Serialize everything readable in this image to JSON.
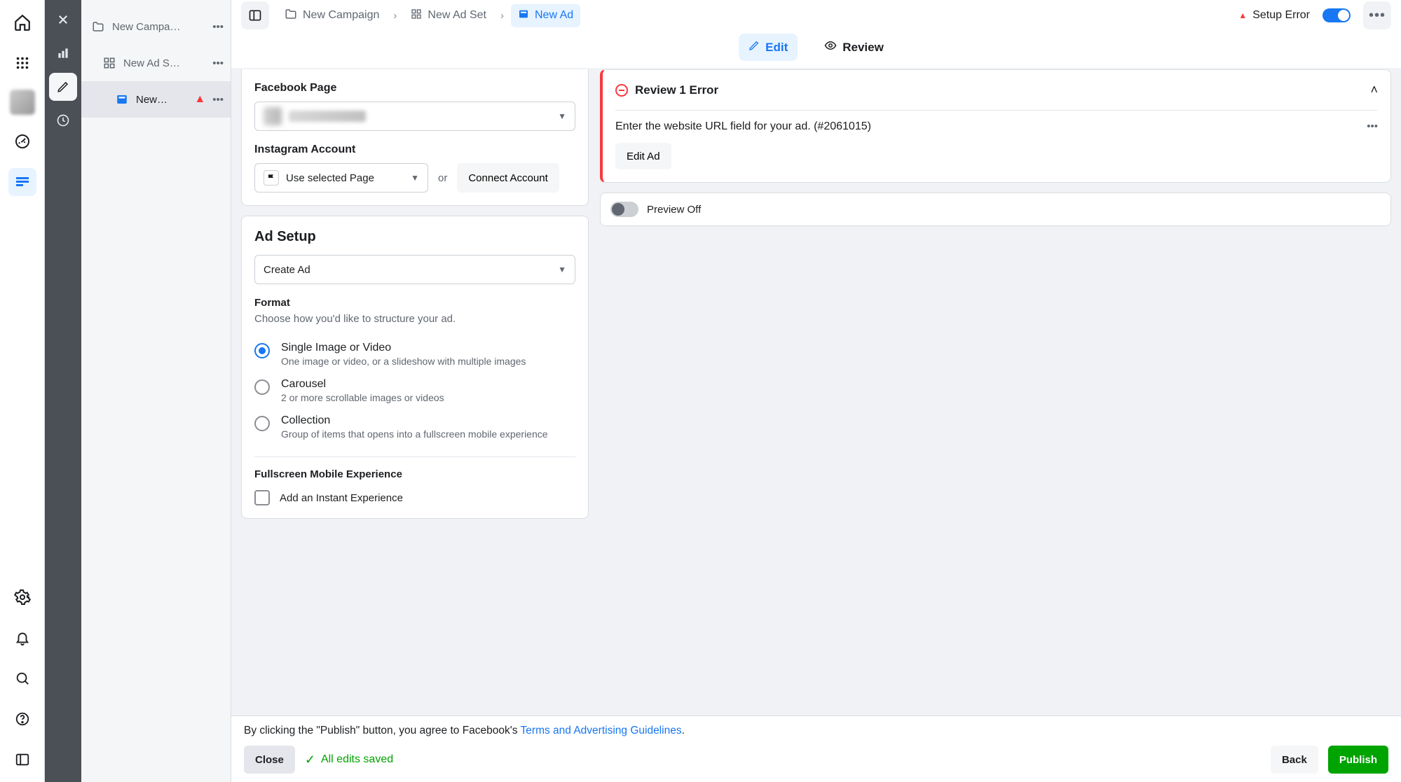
{
  "rail": {
    "items": [
      "home",
      "apps",
      "avatar",
      "dashboard",
      "ads-manager"
    ],
    "bottom": [
      "settings",
      "notifications",
      "search",
      "help",
      "collapse"
    ]
  },
  "midrail": {
    "items": [
      "close",
      "chart",
      "edit",
      "clock"
    ]
  },
  "tree": {
    "items": [
      {
        "label": "New Campa…",
        "depth": 0,
        "icon": "folder"
      },
      {
        "label": "New Ad S…",
        "depth": 1,
        "icon": "grid"
      },
      {
        "label": "New…",
        "depth": 2,
        "icon": "ad",
        "warn": true,
        "selected": true
      }
    ]
  },
  "breadcrumbs": {
    "items": [
      {
        "label": "New Campaign",
        "icon": "folder"
      },
      {
        "label": "New Ad Set",
        "icon": "grid"
      },
      {
        "label": "New Ad",
        "icon": "ad",
        "active": true
      }
    ]
  },
  "header": {
    "setup_error": "Setup Error",
    "toggle_on": true
  },
  "tabs": {
    "edit": "Edit",
    "review": "Review",
    "active": "edit"
  },
  "identity": {
    "fb_page_label": "Facebook Page",
    "ig_label": "Instagram Account",
    "ig_select": "Use selected Page",
    "or": "or",
    "connect": "Connect Account"
  },
  "adsetup": {
    "title": "Ad Setup",
    "create": "Create Ad",
    "format_label": "Format",
    "format_help": "Choose how you'd like to structure your ad.",
    "opts": [
      {
        "title": "Single Image or Video",
        "desc": "One image or video, or a slideshow with multiple images",
        "checked": true
      },
      {
        "title": "Carousel",
        "desc": "2 or more scrollable images or videos",
        "checked": false
      },
      {
        "title": "Collection",
        "desc": "Group of items that opens into a fullscreen mobile experience",
        "checked": false
      }
    ],
    "fullscreen_label": "Fullscreen Mobile Experience",
    "instant": "Add an Instant Experience"
  },
  "errors": {
    "title": "Review 1 Error",
    "msg": "Enter the website URL field for your ad. (#2061015)",
    "edit_ad": "Edit Ad"
  },
  "preview": {
    "label": "Preview Off"
  },
  "footer": {
    "note_prefix": "By clicking the \"Publish\" button, you agree to Facebook's ",
    "note_link": "Terms and Advertising Guidelines",
    "note_suffix": ".",
    "close": "Close",
    "saved": "All edits saved",
    "back": "Back",
    "publish": "Publish"
  }
}
